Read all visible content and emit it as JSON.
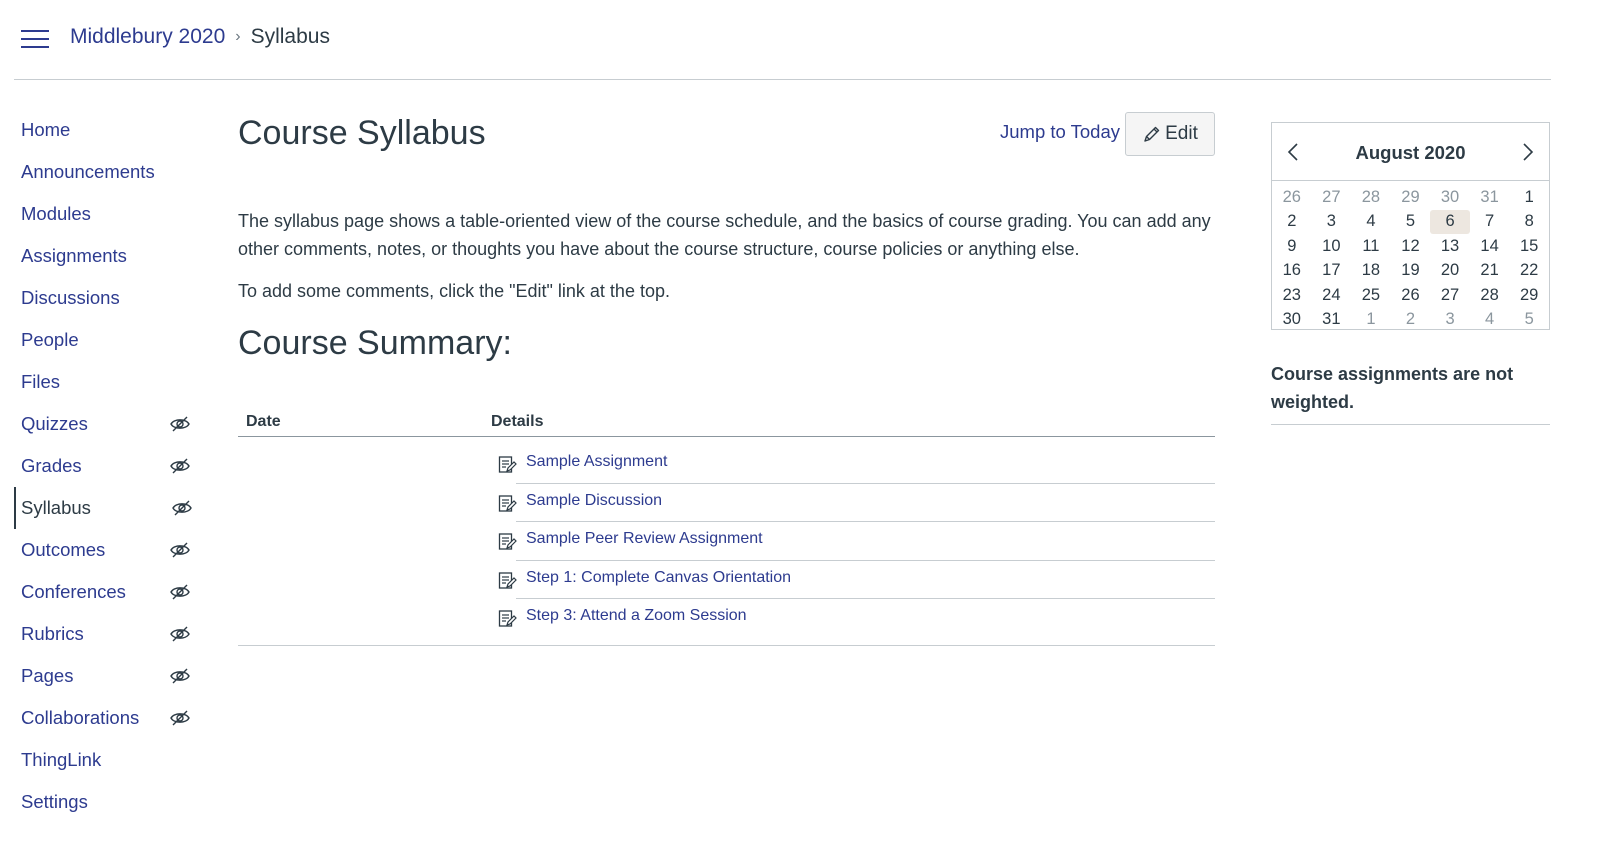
{
  "breadcrumb": {
    "course": "Middlebury 2020",
    "current": "Syllabus"
  },
  "nav": {
    "items": [
      {
        "label": "Home",
        "hidden_icon": false
      },
      {
        "label": "Announcements",
        "hidden_icon": false
      },
      {
        "label": "Modules",
        "hidden_icon": false
      },
      {
        "label": "Assignments",
        "hidden_icon": false
      },
      {
        "label": "Discussions",
        "hidden_icon": false
      },
      {
        "label": "People",
        "hidden_icon": false
      },
      {
        "label": "Files",
        "hidden_icon": false
      },
      {
        "label": "Quizzes",
        "hidden_icon": true
      },
      {
        "label": "Grades",
        "hidden_icon": true
      },
      {
        "label": "Syllabus",
        "hidden_icon": true,
        "active": true
      },
      {
        "label": "Outcomes",
        "hidden_icon": true
      },
      {
        "label": "Conferences",
        "hidden_icon": true
      },
      {
        "label": "Rubrics",
        "hidden_icon": true
      },
      {
        "label": "Pages",
        "hidden_icon": true
      },
      {
        "label": "Collaborations",
        "hidden_icon": true
      },
      {
        "label": "ThingLink",
        "hidden_icon": false
      },
      {
        "label": "Settings",
        "hidden_icon": false
      }
    ]
  },
  "main": {
    "title": "Course Syllabus",
    "jump_today": "Jump to Today",
    "edit_label": "Edit",
    "intro": "The syllabus page shows a table-oriented view of the course schedule, and the basics of course grading. You can add any other comments, notes, or thoughts you have about the course structure, course policies or anything else.",
    "intro2": "To add some comments, click the \"Edit\" link at the top.",
    "summary_title": "Course Summary:",
    "table": {
      "col_date": "Date",
      "col_details": "Details",
      "rows": [
        "Sample Assignment",
        "Sample Discussion",
        "Sample Peer Review Assignment",
        "Step 1: Complete Canvas Orientation",
        "Step 3: Attend a Zoom Session"
      ]
    }
  },
  "calendar": {
    "title": "August 2020",
    "today": "6",
    "weeks": [
      [
        [
          "26",
          true
        ],
        [
          "27",
          true
        ],
        [
          "28",
          true
        ],
        [
          "29",
          true
        ],
        [
          "30",
          true
        ],
        [
          "31",
          true
        ],
        [
          "1",
          false
        ]
      ],
      [
        [
          "2",
          false
        ],
        [
          "3",
          false
        ],
        [
          "4",
          false
        ],
        [
          "5",
          false
        ],
        [
          "6",
          false
        ],
        [
          "7",
          false
        ],
        [
          "8",
          false
        ]
      ],
      [
        [
          "9",
          false
        ],
        [
          "10",
          false
        ],
        [
          "11",
          false
        ],
        [
          "12",
          false
        ],
        [
          "13",
          false
        ],
        [
          "14",
          false
        ],
        [
          "15",
          false
        ]
      ],
      [
        [
          "16",
          false
        ],
        [
          "17",
          false
        ],
        [
          "18",
          false
        ],
        [
          "19",
          false
        ],
        [
          "20",
          false
        ],
        [
          "21",
          false
        ],
        [
          "22",
          false
        ]
      ],
      [
        [
          "23",
          false
        ],
        [
          "24",
          false
        ],
        [
          "25",
          false
        ],
        [
          "26",
          false
        ],
        [
          "27",
          false
        ],
        [
          "28",
          false
        ],
        [
          "29",
          false
        ]
      ],
      [
        [
          "30",
          false
        ],
        [
          "31",
          false
        ],
        [
          "1",
          true
        ],
        [
          "2",
          true
        ],
        [
          "3",
          true
        ],
        [
          "4",
          true
        ],
        [
          "5",
          true
        ]
      ]
    ]
  },
  "weight_note": "Course assignments are not weighted.",
  "colors": {
    "link": "#2d3b8f",
    "text": "#2d3b45",
    "border": "#c7cdd1",
    "today_bg": "#ede7e0"
  }
}
